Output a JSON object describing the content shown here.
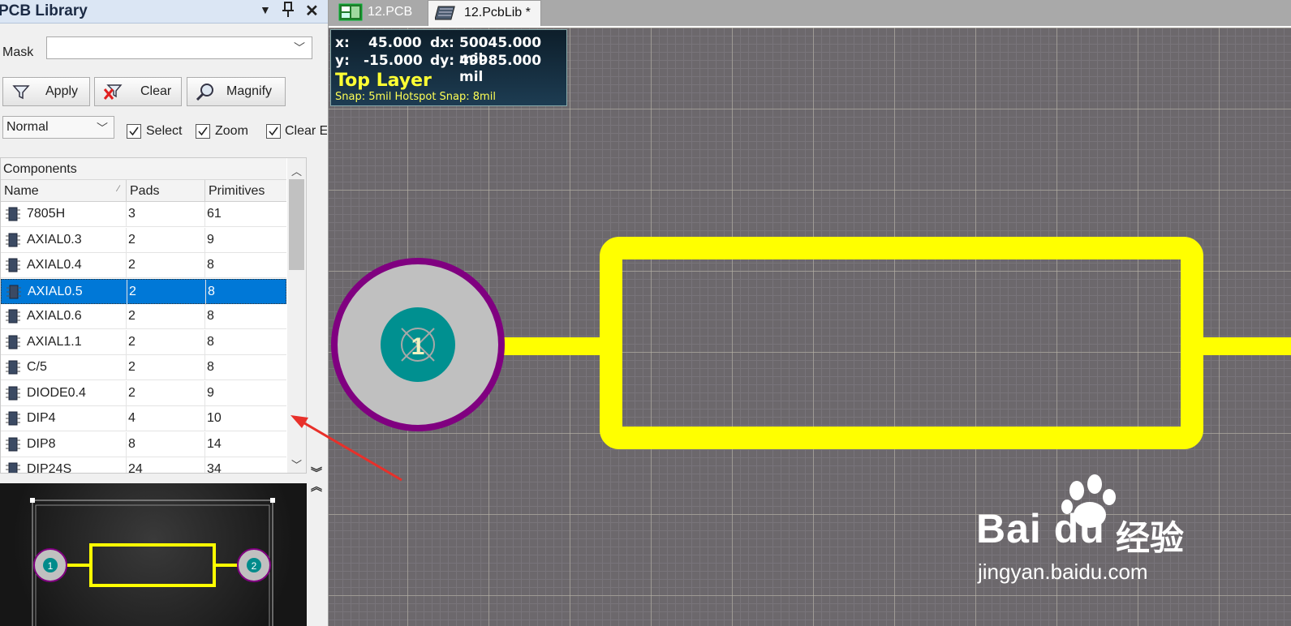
{
  "panel": {
    "title": "PCB Library",
    "mask_label": "Mask",
    "mask_value": "",
    "buttons": {
      "apply": "Apply",
      "clear": "Clear",
      "magnify": "Magnify"
    },
    "mode": "Normal",
    "checkboxes": {
      "select": "Select",
      "zoom": "Zoom",
      "clear_existing": "Clear E"
    },
    "components_label": "Components",
    "columns": {
      "name": "Name",
      "pads": "Pads",
      "primitives": "Primitives"
    },
    "rows": [
      {
        "name": "7805H",
        "pads": "3",
        "primitives": "61"
      },
      {
        "name": "AXIAL0.3",
        "pads": "2",
        "primitives": "9"
      },
      {
        "name": "AXIAL0.4",
        "pads": "2",
        "primitives": "8"
      },
      {
        "name": "AXIAL0.5",
        "pads": "2",
        "primitives": "8"
      },
      {
        "name": "AXIAL0.6",
        "pads": "2",
        "primitives": "8"
      },
      {
        "name": "AXIAL1.1",
        "pads": "2",
        "primitives": "8"
      },
      {
        "name": "C/5",
        "pads": "2",
        "primitives": "8"
      },
      {
        "name": "DIODE0.4",
        "pads": "2",
        "primitives": "9"
      },
      {
        "name": "DIP4",
        "pads": "4",
        "primitives": "10"
      },
      {
        "name": "DIP8",
        "pads": "8",
        "primitives": "14"
      },
      {
        "name": "DIP24S",
        "pads": "24",
        "primitives": "34"
      }
    ],
    "selected_row": "AXIAL0.5",
    "preview_pads": [
      "1",
      "2"
    ]
  },
  "tabs": [
    {
      "label": "12.PCB",
      "icon": "pcb-doc-icon",
      "active": false
    },
    {
      "label": "12.PcbLib *",
      "icon": "pcblib-doc-icon",
      "active": true
    }
  ],
  "hud": {
    "x_label": "x:",
    "x_value": "45.000",
    "dx_label": "dx:",
    "dx_value": "50045.000 mil",
    "y_label": "y:",
    "y_value": "-15.000",
    "dy_label": "dy:",
    "dy_value": "49985.000 mil",
    "layer": "Top Layer",
    "snap": "Snap: 5mil Hotspot Snap: 8mil"
  },
  "canvas": {
    "pad_label": "1"
  },
  "colors": {
    "silkscreen": "#ffff00",
    "pad_ring": "#800080",
    "pad_copper": "#c0c0c0",
    "hole": "#008b8b",
    "selection": "#0078d7"
  },
  "watermark": {
    "brand": "Bai du",
    "cn": "经验",
    "url": "jingyan.baidu.com"
  }
}
